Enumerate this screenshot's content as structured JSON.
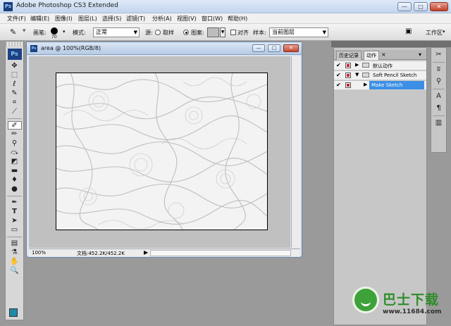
{
  "window": {
    "title": "Adobe Photoshop CS3 Extended",
    "app_icon": "Ps",
    "minimize": "—",
    "maximize": "□",
    "close": "✕"
  },
  "menu": [
    "文件(F)",
    "编辑(E)",
    "图像(I)",
    "图层(L)",
    "选择(S)",
    "滤镜(T)",
    "分析(A)",
    "视图(V)",
    "窗口(W)",
    "帮助(H)"
  ],
  "options": {
    "brush_label": "画笔:",
    "brush_size": "70",
    "mode_label": "模式:",
    "mode_value": "正常",
    "source_label": "源:",
    "source_sampled": "取样",
    "source_pattern": "图案:",
    "aligned": "对齐",
    "sample_label": "样本:",
    "sample_value": "当前图层",
    "workspace": "工作区"
  },
  "tools": {
    "ps_logo": "Ps",
    "icons": [
      "move-icon",
      "marquee-icon",
      "lasso-icon",
      "quick-select-icon",
      "crop-icon",
      "slice-icon",
      "healing-brush-icon",
      "brush-icon",
      "clone-stamp-icon",
      "history-brush-icon",
      "eraser-icon",
      "gradient-icon",
      "blur-icon",
      "dodge-icon",
      "pen-icon",
      "type-icon",
      "path-select-icon",
      "shape-icon",
      "notes-icon",
      "eyedropper-icon",
      "hand-icon",
      "zoom-icon"
    ],
    "selected": "healing-brush-icon",
    "foreground_color": "#1c8ca7"
  },
  "document": {
    "icon": "Ps",
    "title": "area @ 100%(RGB/8)",
    "zoom": "100%",
    "doc_size": "文档:452.2K/452.2K"
  },
  "panel": {
    "tabs": [
      "历史记录",
      "动作"
    ],
    "active_tab": "动作",
    "close_icon": "×",
    "rows": [
      {
        "label": "默认动作",
        "type": "set",
        "checked": true
      },
      {
        "label": "Soft Pencil Sketch",
        "type": "set",
        "checked": true,
        "expanded": true
      },
      {
        "label": "Make Sketch",
        "type": "action",
        "checked": true,
        "selected": true
      }
    ]
  },
  "watermark": {
    "cn": "巴士下载",
    "url": "www.11684.com"
  }
}
